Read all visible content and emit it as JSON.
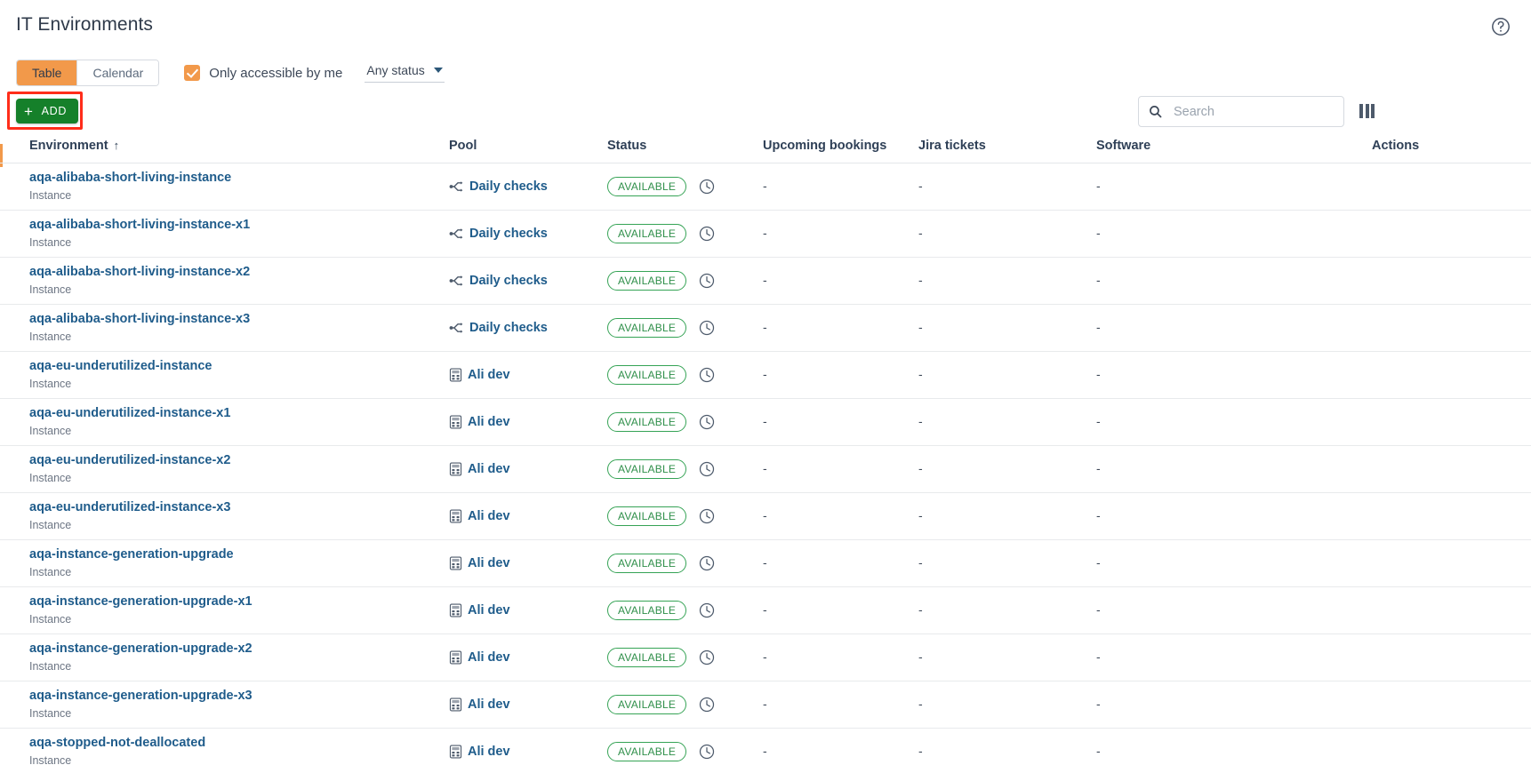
{
  "header": {
    "title": "IT Environments",
    "help_icon": "help-circle-icon"
  },
  "toolbar": {
    "view_tabs": [
      {
        "label": "Table",
        "active": true
      },
      {
        "label": "Calendar",
        "active": false
      }
    ],
    "checkbox": {
      "label": "Only accessible by me",
      "checked": true,
      "color": "#f2994a"
    },
    "status_filter": {
      "label": "Any status",
      "icon": "chevron-down-icon"
    },
    "add_button": {
      "label": "ADD",
      "icon": "plus-icon",
      "color": "#15802a",
      "highlight_color": "#ff2d1a"
    },
    "search": {
      "value": "",
      "placeholder": "Search",
      "icon": "search-icon"
    },
    "columns_button": {
      "icon": "columns-icon"
    }
  },
  "table": {
    "columns": [
      {
        "key": "environment",
        "label": "Environment",
        "sorted": true,
        "sort_icon": "↑"
      },
      {
        "key": "pool",
        "label": "Pool"
      },
      {
        "key": "status",
        "label": "Status"
      },
      {
        "key": "upcoming",
        "label": "Upcoming bookings"
      },
      {
        "key": "jira",
        "label": "Jira tickets"
      },
      {
        "key": "software",
        "label": "Software"
      },
      {
        "key": "actions",
        "label": "Actions"
      }
    ],
    "rows": [
      {
        "environment": "aqa-alibaba-short-living-instance",
        "type": "Instance",
        "pool": "Daily checks",
        "pool_icon": "pipeline-icon",
        "status": "AVAILABLE",
        "status_color": "#35a355",
        "clock_icon": "clock-icon",
        "upcoming": "-",
        "jira": "-",
        "software": "-"
      },
      {
        "environment": "aqa-alibaba-short-living-instance-x1",
        "type": "Instance",
        "pool": "Daily checks",
        "pool_icon": "pipeline-icon",
        "status": "AVAILABLE",
        "status_color": "#35a355",
        "clock_icon": "clock-icon",
        "upcoming": "-",
        "jira": "-",
        "software": "-"
      },
      {
        "environment": "aqa-alibaba-short-living-instance-x2",
        "type": "Instance",
        "pool": "Daily checks",
        "pool_icon": "pipeline-icon",
        "status": "AVAILABLE",
        "status_color": "#35a355",
        "clock_icon": "clock-icon",
        "upcoming": "-",
        "jira": "-",
        "software": "-"
      },
      {
        "environment": "aqa-alibaba-short-living-instance-x3",
        "type": "Instance",
        "pool": "Daily checks",
        "pool_icon": "pipeline-icon",
        "status": "AVAILABLE",
        "status_color": "#35a355",
        "clock_icon": "clock-icon",
        "upcoming": "-",
        "jira": "-",
        "software": "-"
      },
      {
        "environment": "aqa-eu-underutilized-instance",
        "type": "Instance",
        "pool": "Ali dev",
        "pool_icon": "calculator-icon",
        "status": "AVAILABLE",
        "status_color": "#35a355",
        "clock_icon": "clock-icon",
        "upcoming": "-",
        "jira": "-",
        "software": "-"
      },
      {
        "environment": "aqa-eu-underutilized-instance-x1",
        "type": "Instance",
        "pool": "Ali dev",
        "pool_icon": "calculator-icon",
        "status": "AVAILABLE",
        "status_color": "#35a355",
        "clock_icon": "clock-icon",
        "upcoming": "-",
        "jira": "-",
        "software": "-"
      },
      {
        "environment": "aqa-eu-underutilized-instance-x2",
        "type": "Instance",
        "pool": "Ali dev",
        "pool_icon": "calculator-icon",
        "status": "AVAILABLE",
        "status_color": "#35a355",
        "clock_icon": "clock-icon",
        "upcoming": "-",
        "jira": "-",
        "software": "-"
      },
      {
        "environment": "aqa-eu-underutilized-instance-x3",
        "type": "Instance",
        "pool": "Ali dev",
        "pool_icon": "calculator-icon",
        "status": "AVAILABLE",
        "status_color": "#35a355",
        "clock_icon": "clock-icon",
        "upcoming": "-",
        "jira": "-",
        "software": "-"
      },
      {
        "environment": "aqa-instance-generation-upgrade",
        "type": "Instance",
        "pool": "Ali dev",
        "pool_icon": "calculator-icon",
        "status": "AVAILABLE",
        "status_color": "#35a355",
        "clock_icon": "clock-icon",
        "upcoming": "-",
        "jira": "-",
        "software": "-"
      },
      {
        "environment": "aqa-instance-generation-upgrade-x1",
        "type": "Instance",
        "pool": "Ali dev",
        "pool_icon": "calculator-icon",
        "status": "AVAILABLE",
        "status_color": "#35a355",
        "clock_icon": "clock-icon",
        "upcoming": "-",
        "jira": "-",
        "software": "-"
      },
      {
        "environment": "aqa-instance-generation-upgrade-x2",
        "type": "Instance",
        "pool": "Ali dev",
        "pool_icon": "calculator-icon",
        "status": "AVAILABLE",
        "status_color": "#35a355",
        "clock_icon": "clock-icon",
        "upcoming": "-",
        "jira": "-",
        "software": "-"
      },
      {
        "environment": "aqa-instance-generation-upgrade-x3",
        "type": "Instance",
        "pool": "Ali dev",
        "pool_icon": "calculator-icon",
        "status": "AVAILABLE",
        "status_color": "#35a355",
        "clock_icon": "clock-icon",
        "upcoming": "-",
        "jira": "-",
        "software": "-"
      },
      {
        "environment": "aqa-stopped-not-deallocated",
        "type": "Instance",
        "pool": "Ali dev",
        "pool_icon": "calculator-icon",
        "status": "AVAILABLE",
        "status_color": "#35a355",
        "clock_icon": "clock-icon",
        "upcoming": "-",
        "jira": "-",
        "software": "-"
      }
    ]
  }
}
